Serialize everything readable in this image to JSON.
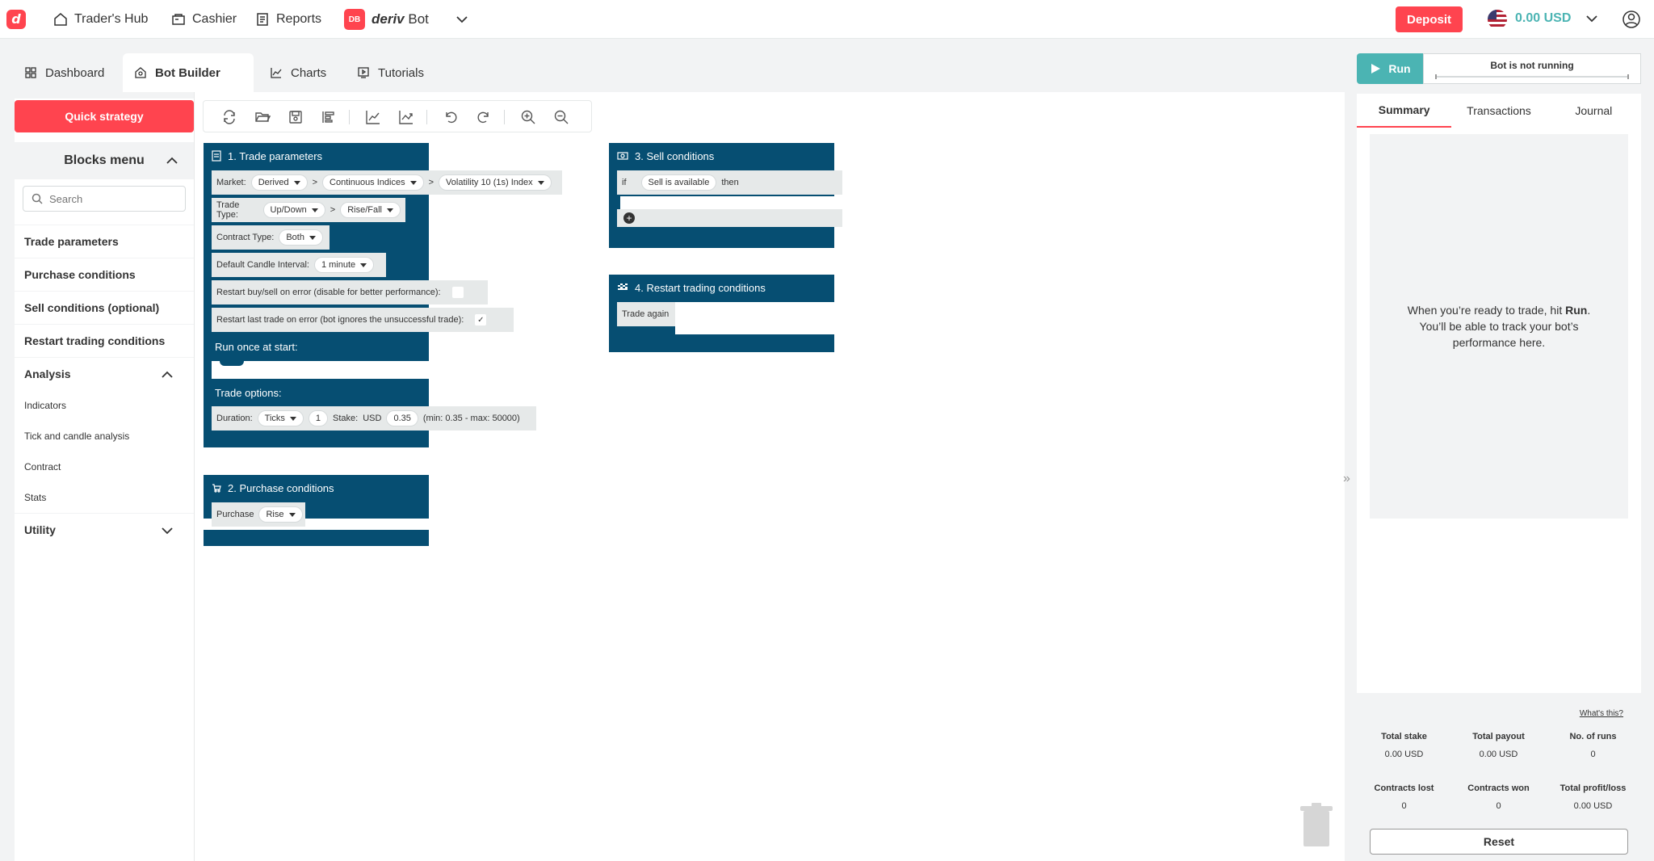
{
  "header": {
    "logo_letter": "d",
    "nav": [
      {
        "label": "Trader's Hub",
        "icon": "home-icon"
      },
      {
        "label": "Cashier",
        "icon": "cashier-icon"
      },
      {
        "label": "Reports",
        "icon": "reports-icon"
      }
    ],
    "app_badge": "DB",
    "app_brand": "deriv",
    "app_name": "Bot",
    "deposit_label": "Deposit",
    "balance": "0.00 USD"
  },
  "tabs": [
    {
      "label": "Dashboard",
      "icon": "dashboard-icon"
    },
    {
      "label": "Bot Builder",
      "icon": "bot-builder-icon",
      "active": true
    },
    {
      "label": "Charts",
      "icon": "charts-icon"
    },
    {
      "label": "Tutorials",
      "icon": "tutorials-icon"
    }
  ],
  "blocks_menu": {
    "quick_strategy": "Quick strategy",
    "title": "Blocks menu",
    "search_placeholder": "Search",
    "categories": [
      "Trade parameters",
      "Purchase conditions",
      "Sell conditions (optional)",
      "Restart trading conditions"
    ],
    "analysis": {
      "label": "Analysis",
      "items": [
        "Indicators",
        "Tick and candle analysis",
        "Contract",
        "Stats"
      ]
    },
    "utility": "Utility"
  },
  "workspace": {
    "trade_parameters": {
      "title": "1. Trade parameters",
      "market_label": "Market:",
      "market": "Derived",
      "submarket": "Continuous Indices",
      "symbol": "Volatility 10 (1s) Index",
      "sep": ">",
      "trade_type_label": "Trade Type:",
      "trade_type": "Up/Down",
      "trade_subtype": "Rise/Fall",
      "contract_type_label": "Contract Type:",
      "contract_type": "Both",
      "candle_interval_label": "Default Candle Interval:",
      "candle_interval": "1 minute",
      "restart_buy_sell": "Restart buy/sell on error (disable for better performance):",
      "restart_last_trade": "Restart last trade on error (bot ignores the unsuccessful trade):",
      "check_mark": "✓",
      "run_once": "Run once at start:",
      "trade_options": "Trade options:",
      "duration_label": "Duration:",
      "duration_unit": "Ticks",
      "duration_value": "1",
      "stake_label": "Stake:",
      "currency": "USD",
      "stake_value": "0.35",
      "stake_range": "(min: 0.35 - max: 50000)"
    },
    "purchase_conditions": {
      "title": "2. Purchase conditions",
      "purchase_label": "Purchase",
      "purchase_value": "Rise"
    },
    "sell_conditions": {
      "title": "3. Sell conditions",
      "if_label": "if",
      "condition": "Sell is available",
      "then_label": "then",
      "add_symbol": "+"
    },
    "restart_conditions": {
      "title": "4. Restart trading conditions",
      "trade_again": "Trade again"
    }
  },
  "right_panel": {
    "run_label": "Run",
    "status": "Bot is not running",
    "tabs": [
      "Summary",
      "Transactions",
      "Journal"
    ],
    "empty_text_before": "When you’re ready to trade, hit ",
    "empty_text_bold": "Run",
    "empty_text_after": ". You’ll be able to track your bot’s performance here.",
    "whats_this": "What's this?",
    "stats": [
      {
        "label": "Total stake",
        "value": "0.00 USD"
      },
      {
        "label": "Total payout",
        "value": "0.00 USD"
      },
      {
        "label": "No. of runs",
        "value": "0"
      },
      {
        "label": "Contracts lost",
        "value": "0"
      },
      {
        "label": "Contracts won",
        "value": "0"
      },
      {
        "label": "Total profit/loss",
        "value": "0.00 USD"
      }
    ],
    "reset_label": "Reset"
  },
  "colors": {
    "brand_red": "#ff444f",
    "block_blue": "#064e72",
    "teal": "#4bb4b3"
  }
}
